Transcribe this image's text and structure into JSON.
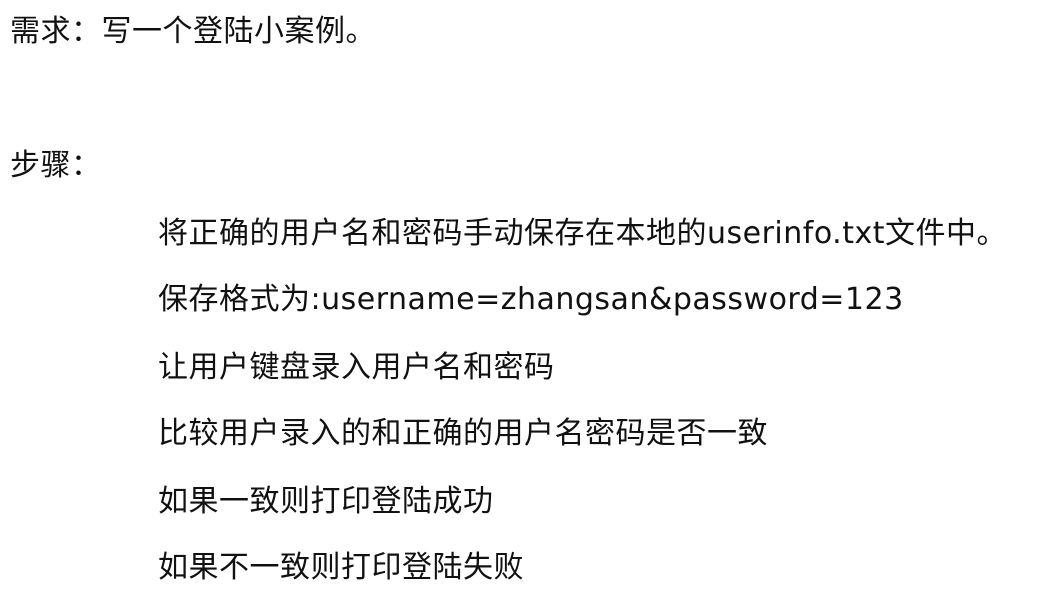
{
  "document": {
    "requirement": "需求：写一个登陆小案例。",
    "steps_title": "步骤：",
    "steps": [
      "将正确的用户名和密码手动保存在本地的userinfo.txt文件中。",
      "保存格式为:username=zhangsan&password=123",
      "让用户键盘录入用户名和密码",
      "比较用户录入的和正确的用户名密码是否一致",
      "如果一致则打印登陆成功",
      "如果不一致则打印登陆失败"
    ]
  }
}
